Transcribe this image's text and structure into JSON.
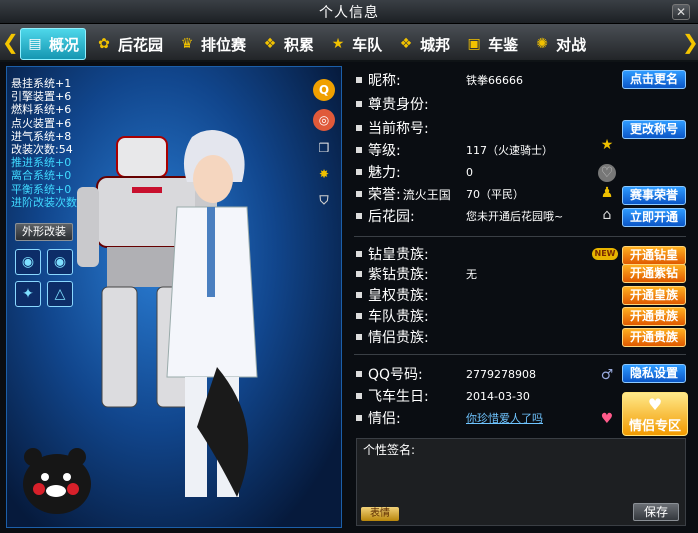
{
  "window": {
    "title": "个人信息",
    "close": "✕"
  },
  "tabs": [
    {
      "label": "概况",
      "icon": "id-card-icon",
      "glyph": "▤",
      "active": true
    },
    {
      "label": "后花园",
      "icon": "garden-icon",
      "glyph": "✿"
    },
    {
      "label": "排位赛",
      "icon": "wings-trophy-icon",
      "glyph": "♛"
    },
    {
      "label": "积累",
      "icon": "stack-icon",
      "glyph": "❖"
    },
    {
      "label": "车队",
      "icon": "star-icon",
      "glyph": "★"
    },
    {
      "label": "城邦",
      "icon": "stack-icon",
      "glyph": "❖"
    },
    {
      "label": "车鉴",
      "icon": "book-icon",
      "glyph": "▣"
    },
    {
      "label": "对战",
      "icon": "paw-icon",
      "glyph": "✺"
    }
  ],
  "left": {
    "stats": [
      {
        "text": "悬挂系统+1",
        "color": "white"
      },
      {
        "text": "引擎装置+6",
        "color": "white"
      },
      {
        "text": "燃料系统+6",
        "color": "white"
      },
      {
        "text": "点火装置+6",
        "color": "white"
      },
      {
        "text": "进气系统+8",
        "color": "white"
      },
      {
        "text": "改装次数:54",
        "color": "white"
      },
      {
        "text": "推进系统+0",
        "color": "cyan"
      },
      {
        "text": "离合系统+0",
        "color": "cyan"
      },
      {
        "text": "平衡系统+0",
        "color": "cyan"
      },
      {
        "text": "进阶改装次数:0",
        "color": "cyan"
      }
    ],
    "mod_button": "外形改装"
  },
  "info": {
    "nickname_label": "昵称:",
    "nickname": "铁拳66666",
    "rename_btn": "点击更名",
    "vip_label": "尊贵身份:",
    "title_label": "当前称号:",
    "change_title_btn": "更改称号",
    "level_label": "等级:",
    "level_value": "117（火速骑士）",
    "charm_label": "魅力:",
    "charm_value": "0",
    "honor_label": "荣誉:",
    "honor_kingdom": "流火王国",
    "honor_value": "70（平民）",
    "honor_btn": "赛事荣誉",
    "garden_label": "后花园:",
    "garden_value": "您未开通后花园哦~",
    "garden_btn": "立即开通"
  },
  "nobles": [
    {
      "label": "钻皇贵族:",
      "value": "",
      "btn": "开通钻皇",
      "new": true
    },
    {
      "label": "紫钻贵族:",
      "value": "无",
      "btn": "开通紫钻"
    },
    {
      "label": "皇权贵族:",
      "value": "",
      "btn": "开通皇族"
    },
    {
      "label": "车队贵族:",
      "value": "",
      "btn": "开通贵族"
    },
    {
      "label": "情侣贵族:",
      "value": "",
      "btn": "开通贵族"
    }
  ],
  "new_badge": "NEW",
  "social": {
    "qq_label": "QQ号码:",
    "qq_value": "2779278908",
    "privacy_btn": "隐私设置",
    "birthday_label": "飞车生日:",
    "birthday_value": "2014-03-30",
    "lover_label": "情侣:",
    "lover_value": "你珍惜爱人了吗",
    "lover_btn": "情侣专区"
  },
  "signature": {
    "label": "个性签名:",
    "emoji_btn": "表情",
    "save_btn": "保存"
  }
}
